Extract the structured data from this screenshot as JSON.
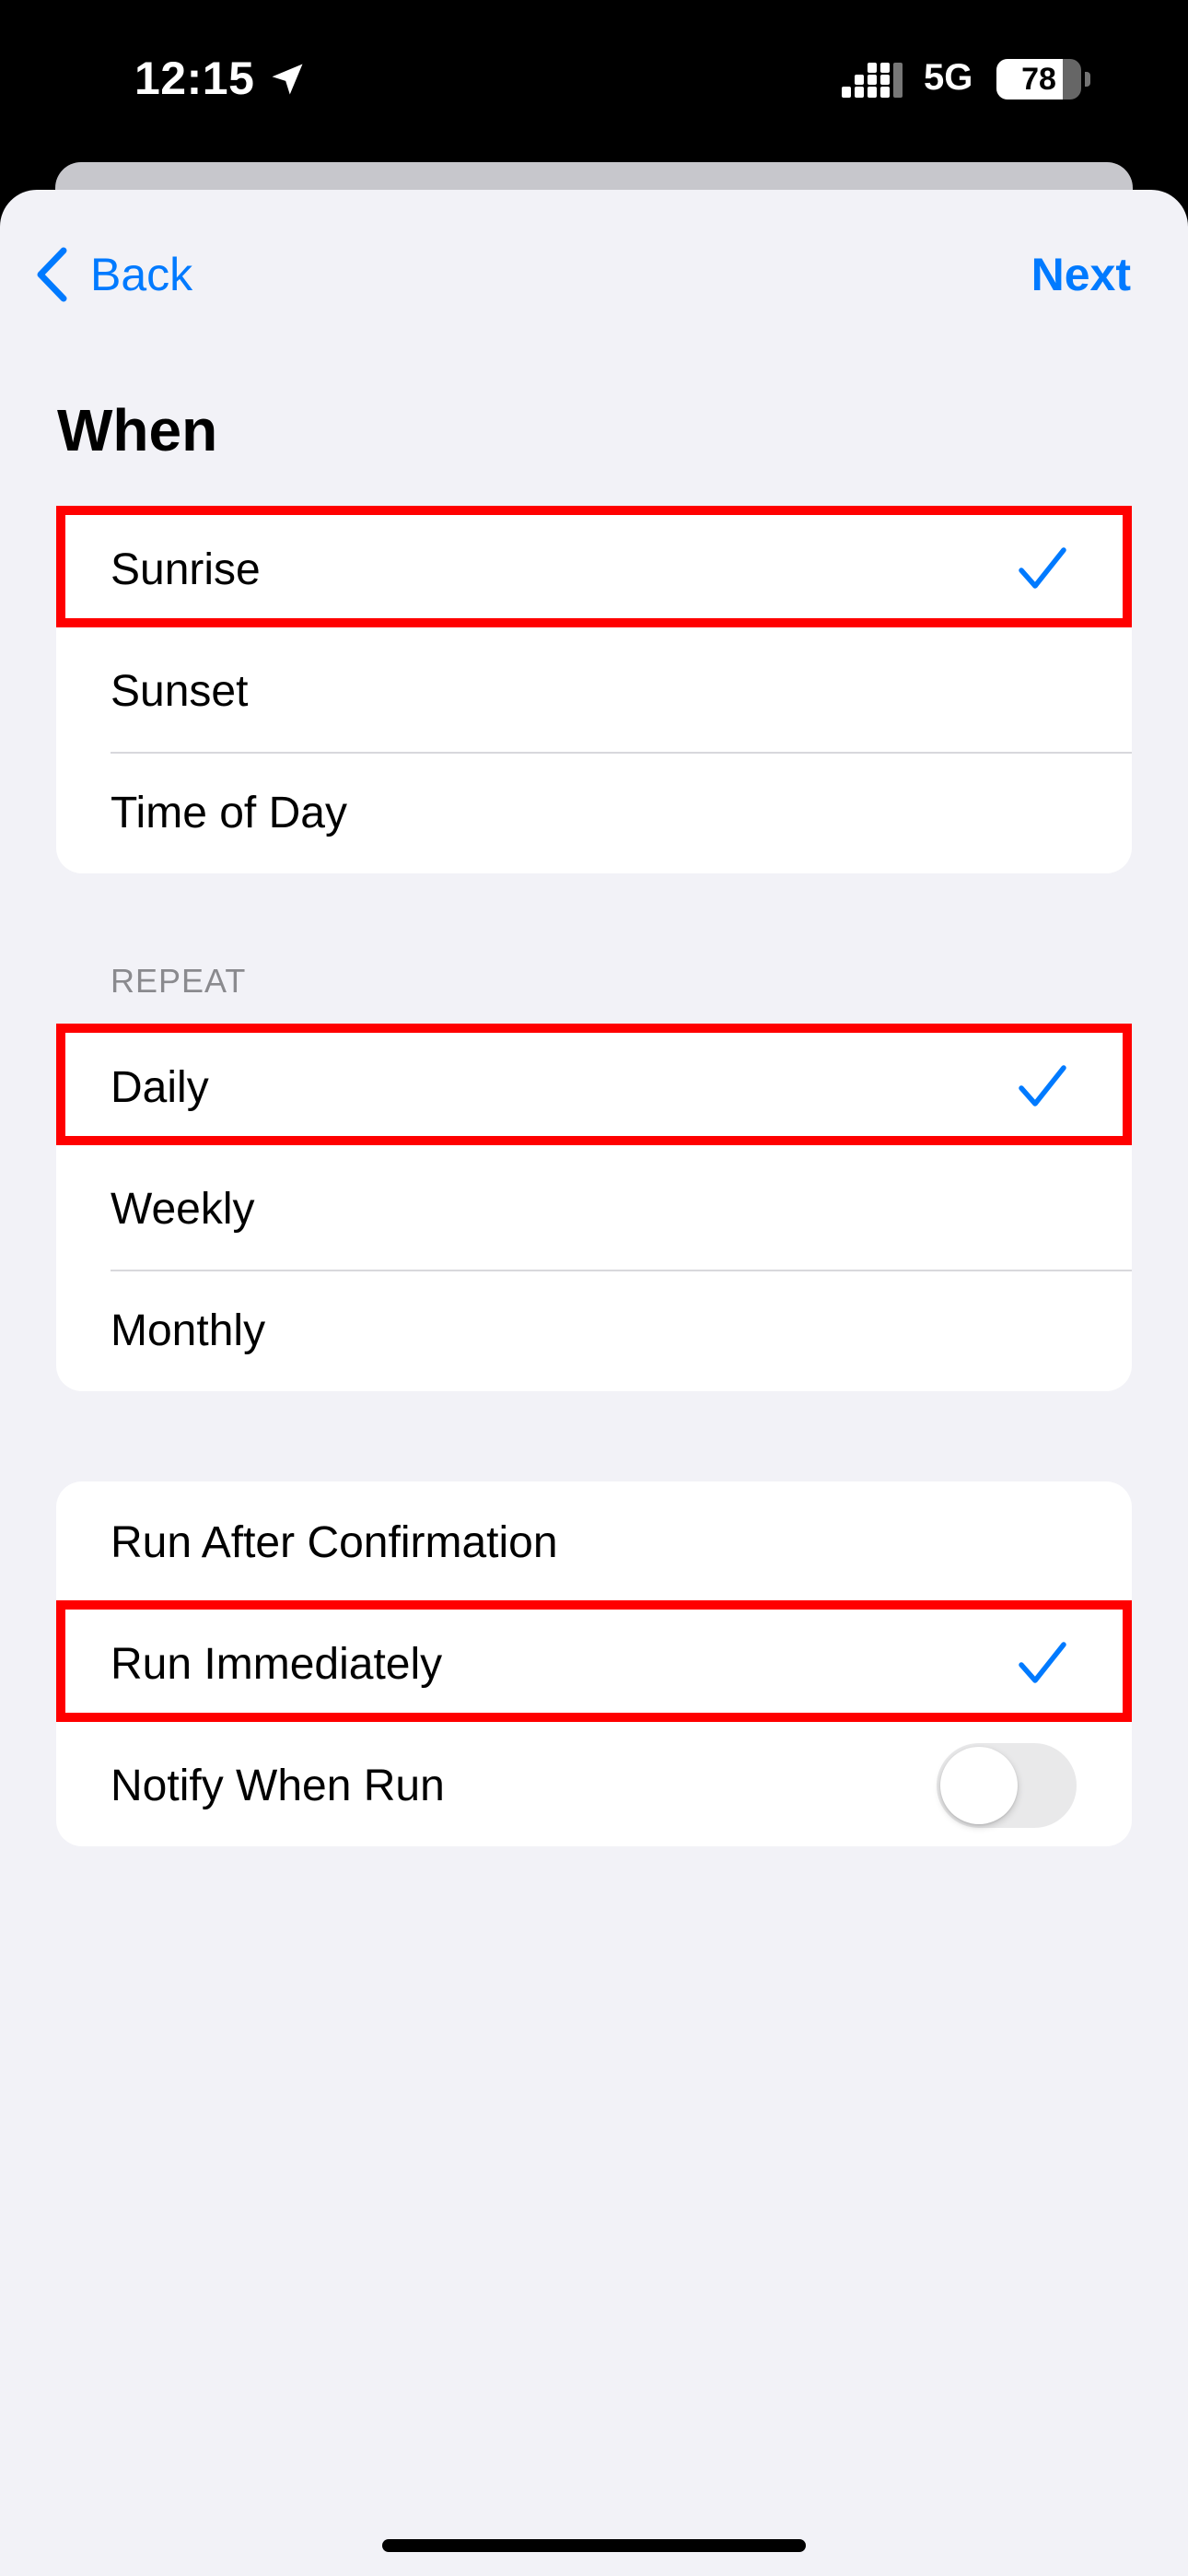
{
  "status_bar": {
    "time": "12:15",
    "network": "5G",
    "battery_level": "78",
    "battery_fraction": 0.78
  },
  "nav": {
    "back_label": "Back",
    "next_label": "Next"
  },
  "when": {
    "title": "When",
    "options": [
      {
        "label": "Sunrise",
        "selected": true
      },
      {
        "label": "Sunset",
        "selected": false
      },
      {
        "label": "Time of Day",
        "selected": false
      }
    ]
  },
  "repeat": {
    "header": "REPEAT",
    "options": [
      {
        "label": "Daily",
        "selected": true
      },
      {
        "label": "Weekly",
        "selected": false
      },
      {
        "label": "Monthly",
        "selected": false
      }
    ]
  },
  "run": {
    "options": [
      {
        "label": "Run After Confirmation",
        "selected": false
      },
      {
        "label": "Run Immediately",
        "selected": true
      }
    ],
    "notify_label": "Notify When Run",
    "notify_on": false
  },
  "colors": {
    "accent": "#007aff",
    "highlight": "#ff0000",
    "background": "#f2f2f7"
  }
}
